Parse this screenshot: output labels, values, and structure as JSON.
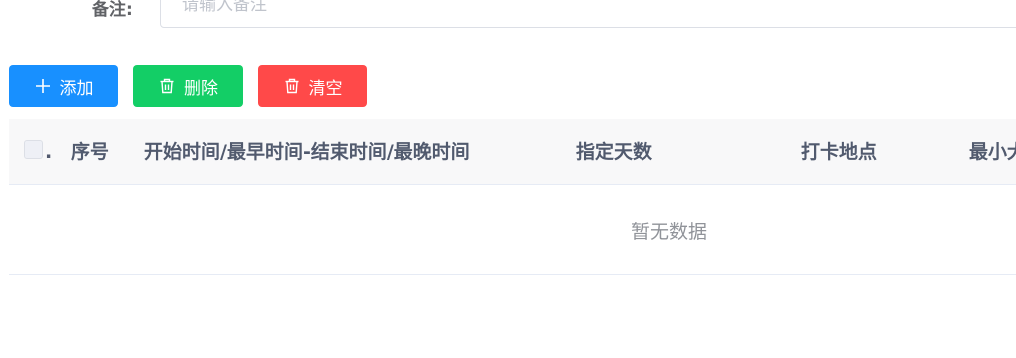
{
  "form": {
    "remark_label": "备注:",
    "remark_placeholder": "请输入备注",
    "remark_value": ""
  },
  "toolbar": {
    "add_label": "添加",
    "delete_label": "删除",
    "clear_label": "清空",
    "add_color": "#1890ff",
    "delete_color": "#13ce66",
    "clear_color": "#ff4949",
    "add_icon": "plus-icon",
    "delete_icon": "trash-icon",
    "clear_icon": "trash-icon"
  },
  "table": {
    "columns": [
      ".",
      "序号",
      "开始时间/最早时间-结束时间/最晚时间",
      "指定天数",
      "打卡地点",
      "最小犬"
    ],
    "rows": [],
    "empty_text": "暂无数据"
  }
}
